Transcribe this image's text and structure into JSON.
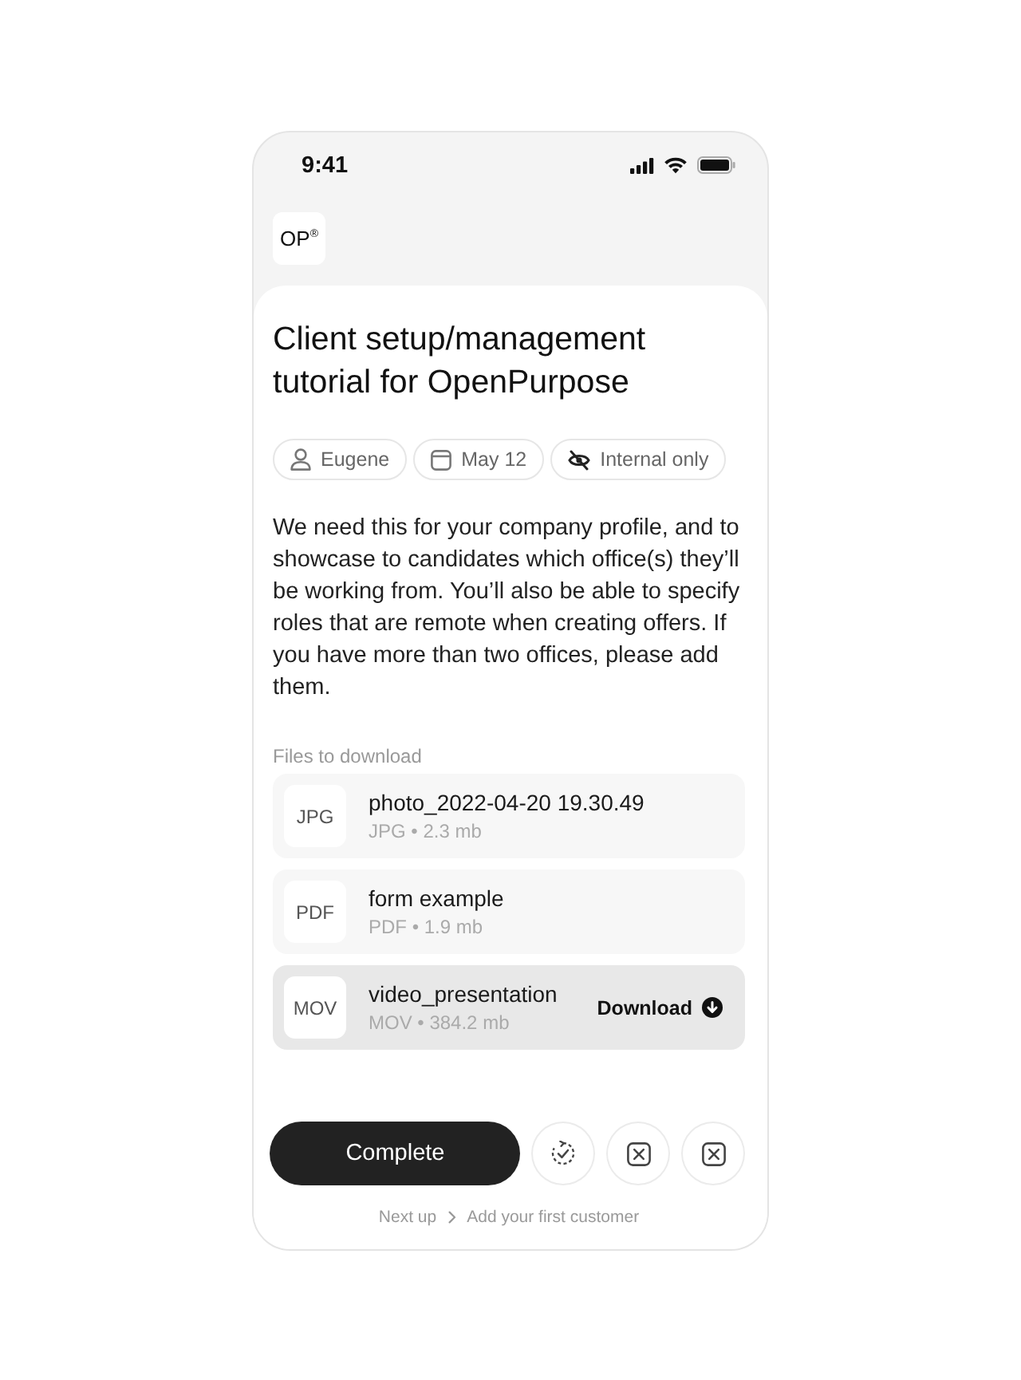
{
  "status_bar": {
    "time": "9:41"
  },
  "logo": {
    "text": "OP$^{®}$"
  },
  "task": {
    "title": "Client setup/management tutorial for OpenPurpose",
    "chips": [
      {
        "kind": "person",
        "label": "Eugene"
      },
      {
        "kind": "date",
        "label": "May 12"
      },
      {
        "kind": "visibility",
        "label": "Internal only"
      }
    ],
    "description": "We need this for your company profile, and to showcase to candidates which office(s) they’ll be working from. You’ll also be able to specify roles that are remote when creating offers. If you have more than two offices, please add them."
  },
  "files": {
    "heading": "Files to download",
    "items": [
      {
        "type": "JPG",
        "name": "photo_2022-04-20 19.30.49",
        "meta": "JPG • 2.3 mb",
        "selected": false
      },
      {
        "type": "PDF",
        "name": "form example",
        "meta": "PDF • 1.9 mb",
        "selected": false
      },
      {
        "type": "MOV",
        "name": "video_presentation",
        "meta": "MOV • 384.2 mb",
        "selected": true,
        "action": "Download"
      }
    ]
  },
  "actions": {
    "primary": "Complete",
    "icon_buttons": [
      {
        "kind": "recheck"
      },
      {
        "kind": "close"
      },
      {
        "kind": "close"
      }
    ]
  },
  "footer": {
    "prefix": "Next up",
    "next": "Add your first customer"
  }
}
